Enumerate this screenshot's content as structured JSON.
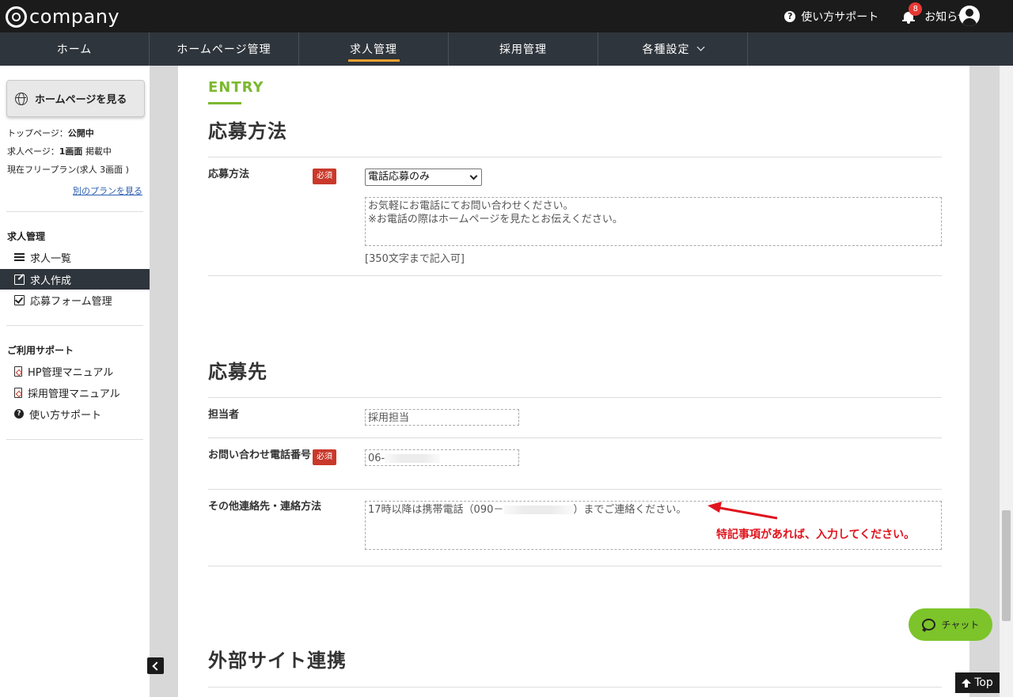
{
  "header": {
    "logo": "@company",
    "support_label": "使い方サポート",
    "notices_label": "お知らせ",
    "notice_count": "8"
  },
  "nav": {
    "items": [
      {
        "label": "ホーム"
      },
      {
        "label": "ホームページ管理"
      },
      {
        "label": "求人管理",
        "active": true
      },
      {
        "label": "採用管理"
      },
      {
        "label": "各種設定"
      }
    ]
  },
  "sidebar": {
    "hp_button": "ホームページを見る",
    "status": {
      "top_page_label": "トップページ：",
      "top_page_value": "公開中",
      "job_page_label": "求人ページ：",
      "job_page_count": "1画面",
      "job_page_state": "掲載中",
      "plan_text": "現在フリープラン(求人 3画面 )"
    },
    "plan_link": "別のプランを見る",
    "job_heading": "求人管理",
    "job_items": [
      {
        "label": "求人一覧"
      },
      {
        "label": "求人作成",
        "active": true
      },
      {
        "label": "応募フォーム管理"
      }
    ],
    "support_heading": "ご利用サポート",
    "support_items": [
      {
        "label": "HP管理マニュアル"
      },
      {
        "label": "採用管理マニュアル"
      },
      {
        "label": "使い方サポート"
      }
    ]
  },
  "main": {
    "entry_label": "ENTRY",
    "apply_section": {
      "title": "応募方法",
      "method_label": "応募方法",
      "required": "必須",
      "method_value": "電話応募のみ",
      "message_line1": "お気軽にお電話にてお問い合わせください。",
      "message_line2": "※お電話の際はホームページを見たとお伝えください。",
      "limit_note": "[350文字まで記入可]"
    },
    "destination_section": {
      "title": "応募先",
      "contact_person_label": "担当者",
      "contact_person_value": "採用担当",
      "phone_label": "お問い合わせ電話番号",
      "phone_value": "06-",
      "other_label": "その他連絡先・連絡方法",
      "other_value_prefix": "17時以降は携帯電話（090－",
      "other_value_suffix": "）までご連絡ください。",
      "annotation": "特記事項があれば、入力してください。"
    },
    "external_section": {
      "title": "外部サイト連携"
    }
  },
  "floating": {
    "chat_label": "チャット",
    "top_label": "Top"
  },
  "colors": {
    "accent_green": "#7cb82f",
    "required_red": "#c9392b",
    "annotation_red": "#e0141e",
    "nav_active_underline": "#f0a030"
  }
}
